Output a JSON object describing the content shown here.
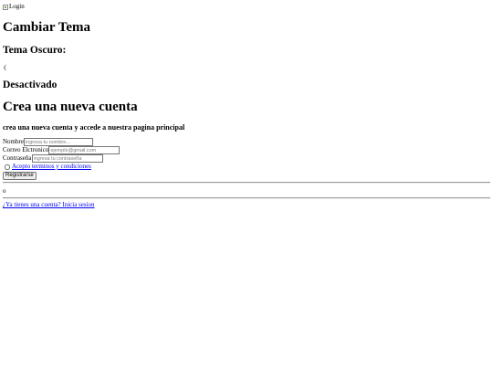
{
  "header": {
    "logo_alt": "Login"
  },
  "theme": {
    "title": "Cambiar Tema",
    "dark_label": "Tema Oscuro:",
    "status": "Desactivado"
  },
  "signup": {
    "title": "Crea una nueva cuenta",
    "subtitle": "crea una nueva cuenta y accede a nuestra pagina principal",
    "name_label": "Nombre",
    "name_placeholder": "ingresa tu nombre...",
    "email_label": "Correo Elctronico",
    "email_placeholder": "ejemplo@gmail.com",
    "password_label": "Contraseña",
    "password_placeholder": "ingresa tu contraseña",
    "terms_label": "Acepto terminos y condiciones",
    "submit_label": "Registrarse",
    "or_text": "o",
    "login_prompt": "¿Ya tienes una cuenta? Inicia sesion"
  },
  "colors": {
    "link": "#0000ee",
    "divider": "#9a9a9a"
  }
}
